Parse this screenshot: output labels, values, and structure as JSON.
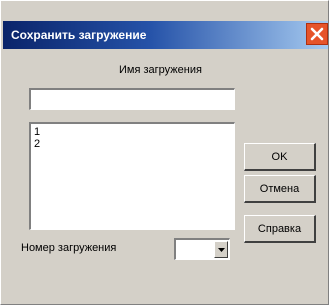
{
  "window": {
    "title": "Сохранить загружение",
    "close_icon": "close-icon"
  },
  "form": {
    "name_label": "Имя загружения",
    "name_value": "",
    "list_items": [
      "1",
      "2"
    ],
    "number_label": "Номер загружения",
    "number_value": ""
  },
  "buttons": {
    "ok": "OK",
    "cancel": "Отмена",
    "help": "Справка"
  },
  "colors": {
    "title_start": "#0a246a",
    "title_end": "#a6caf0",
    "close_bg": "#e6542a",
    "face": "#d4d0c8"
  }
}
